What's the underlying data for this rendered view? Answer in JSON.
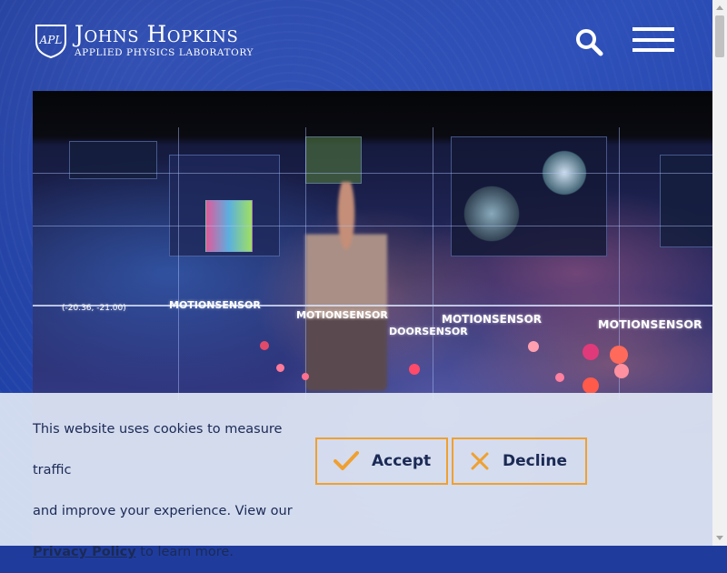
{
  "header": {
    "logo": {
      "badge_text": "APL",
      "title": "Johns Hopkins",
      "subtitle": "APPLIED PHYSICS LABORATORY"
    },
    "search_icon": "search-icon",
    "menu_icon": "hamburger-menu-icon"
  },
  "hero": {
    "labels": {
      "motion1": "MOTIONSENSOR",
      "motion2": "MOTIONSENSOR",
      "motion3": "MOTIONSENSOR",
      "motion4": "MOTIONSENSOR",
      "door": "DOORSENSOR",
      "coords": "(-20.36, -21.00)"
    }
  },
  "cookie_banner": {
    "line1": "This website uses cookies to measure traffic",
    "line2": "and improve your experience. View our",
    "privacy_link": "Privacy Policy",
    "line3_suffix": " to learn more.",
    "accept_label": "Accept",
    "decline_label": "Decline",
    "accent_color": "#f0a030"
  }
}
